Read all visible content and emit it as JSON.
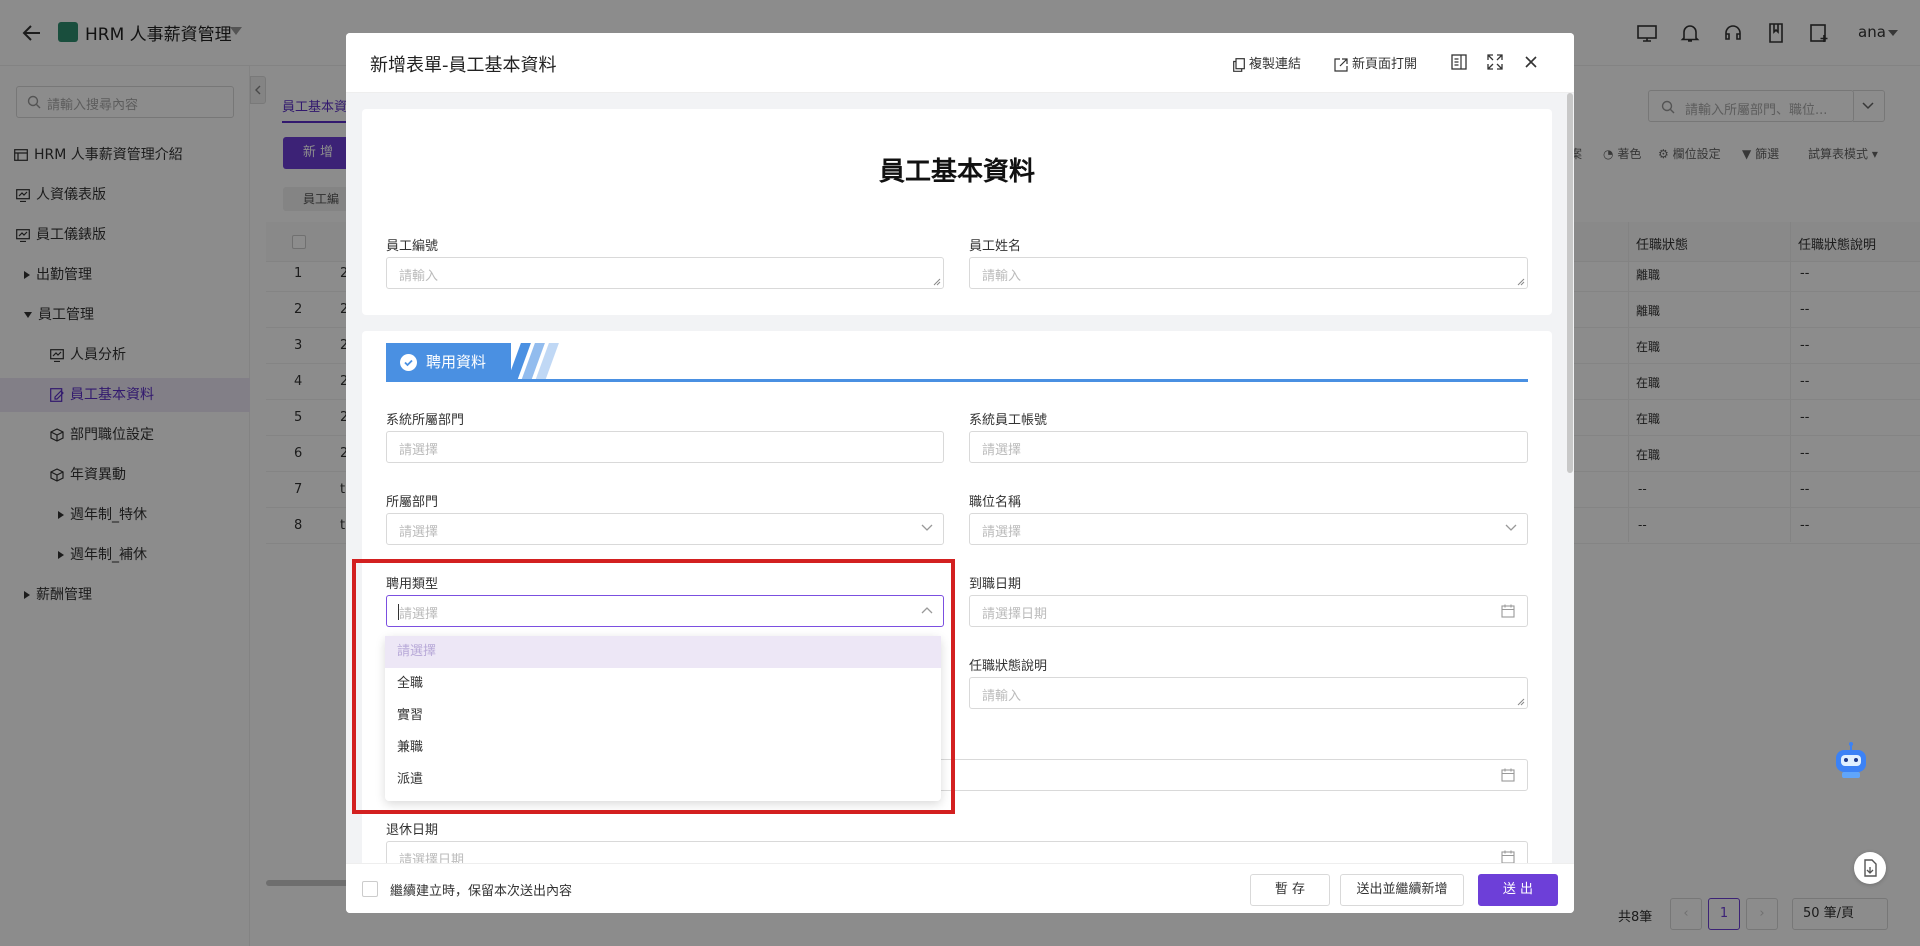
{
  "header": {
    "app_title": "HRM 人事薪資管理",
    "username": "ana"
  },
  "sidebar": {
    "search_placeholder": "請輸入搜尋內容",
    "items": [
      {
        "label": "HRM 人事薪資管理介紹"
      },
      {
        "label": "人資儀表版"
      },
      {
        "label": "員工儀錶版"
      },
      {
        "label": "出勤管理"
      },
      {
        "label": "員工管理"
      },
      {
        "label": "人員分析"
      },
      {
        "label": "員工基本資料"
      },
      {
        "label": "部門職位設定"
      },
      {
        "label": "年資異動"
      },
      {
        "label": "週年制_特休"
      },
      {
        "label": "週年制_補休"
      },
      {
        "label": "薪酬管理"
      }
    ]
  },
  "main": {
    "tab": "員工基本資",
    "new_button": "新 增",
    "chip": "員工編",
    "right_search_placeholder": "請輸入所屬部門、職位...",
    "toolbar": [
      "案",
      "著色",
      "欄位設定",
      "篩選",
      "試算表模式"
    ],
    "columns": {
      "status": "任職狀態",
      "status_desc": "任職狀態說明"
    },
    "rows": [
      {
        "no": "1",
        "c1": "2",
        "status": "離職",
        "desc": "--"
      },
      {
        "no": "2",
        "c1": "2",
        "status": "離職",
        "desc": "--"
      },
      {
        "no": "3",
        "c1": "2",
        "status": "在職",
        "desc": "--"
      },
      {
        "no": "4",
        "c1": "2",
        "status": "在職",
        "desc": "--"
      },
      {
        "no": "5",
        "c1": "2",
        "status": "在職",
        "desc": "--"
      },
      {
        "no": "6",
        "c1": "2",
        "status": "在職",
        "desc": "--"
      },
      {
        "no": "7",
        "c1": "t",
        "status": "--",
        "desc": "--"
      },
      {
        "no": "8",
        "c1": "t",
        "status": "--",
        "desc": "--"
      }
    ],
    "pager": {
      "total": "共8筆",
      "page": "1",
      "page_size": "50 筆/頁"
    }
  },
  "modal": {
    "title": "新增表單-員工基本資料",
    "actions": {
      "copy_link": "複製連結",
      "open_new_page": "新頁面打開"
    },
    "form_title": "員工基本資料",
    "fields": {
      "emp_no": {
        "label": "員工編號",
        "placeholder": "請輸入"
      },
      "emp_name": {
        "label": "員工姓名",
        "placeholder": "請輸入"
      },
      "sys_dept": {
        "label": "系統所屬部門",
        "placeholder": "請選擇"
      },
      "sys_account": {
        "label": "系統員工帳號",
        "placeholder": "請選擇"
      },
      "dept": {
        "label": "所屬部門",
        "placeholder": "請選擇"
      },
      "position": {
        "label": "職位名稱",
        "placeholder": "請選擇"
      },
      "hire_type": {
        "label": "聘用類型",
        "placeholder": "請選擇"
      },
      "hire_date": {
        "label": "到職日期",
        "placeholder": "請選擇日期"
      },
      "status_desc": {
        "label": "任職狀態說明",
        "placeholder": "請輸入"
      },
      "retire_date": {
        "label": "退休日期",
        "placeholder": "請選擇日期"
      }
    },
    "section": {
      "label": "聘用資料"
    },
    "dropdown": {
      "options": [
        "請選擇",
        "全職",
        "實習",
        "兼職",
        "派遣"
      ]
    },
    "footer": {
      "keep_text": "繼續建立時，保留本次送出內容",
      "save": "暫 存",
      "submit_continue": "送出並繼續新增",
      "submit": "送 出"
    }
  },
  "colors": {
    "accent": "#6d3fd8",
    "section": "#4a90e2",
    "highlight": "#d32020"
  }
}
